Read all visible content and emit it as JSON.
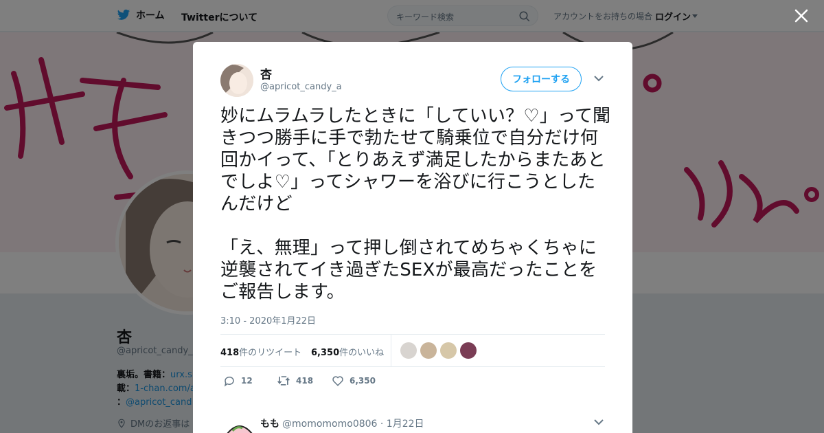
{
  "nav": {
    "home_label": "ホーム",
    "about_label": "Twitterについて",
    "search_placeholder": "キーワード検索",
    "login_prompt": "アカウントをお持ちの場合",
    "login_label": "ログイン"
  },
  "profile": {
    "name": "杏",
    "handle": "@apricot_candy_",
    "bio_line1_label": "裏垢。書籍：",
    "bio_line1_link": "urx.s",
    "bio_line2_label": "載：",
    "bio_line2_link": "1-chan.com/a",
    "bio_line3_label": "：",
    "bio_line3_link": "@apricot_cand",
    "location": "DMのお返事は"
  },
  "tweet": {
    "author_name": "杏",
    "author_handle": "@apricot_candy_a",
    "follow_label": "フォローする",
    "text": "妙にムラムラしたときに「していい？♡」って聞きつつ勝手に手で勃たせて騎乗位で自分だけ何回かイって、「とりあえず満足したからまたあとでしよ♡」ってシャワーを浴びに行こうとしたんだけど\n\n「え、無理」って押し倒されてめちゃくちゃに逆襲されてイき過ぎたSEXが最高だったことをご報告します。",
    "timestamp": "3:10 - 2020年1月22日",
    "retweet_count": "418",
    "retweet_suffix": "件のリツイート",
    "like_count": "6,350",
    "like_suffix": "件のいいね",
    "actions": {
      "reply_count": "12",
      "retweet_count": "418",
      "like_count": "6,350"
    }
  },
  "reply": {
    "name": "もも",
    "handle": "@momomomo0806",
    "date": "· 1月22日"
  },
  "colors": {
    "brand": "#1da1f2",
    "banner_ink": "#c2185b"
  }
}
